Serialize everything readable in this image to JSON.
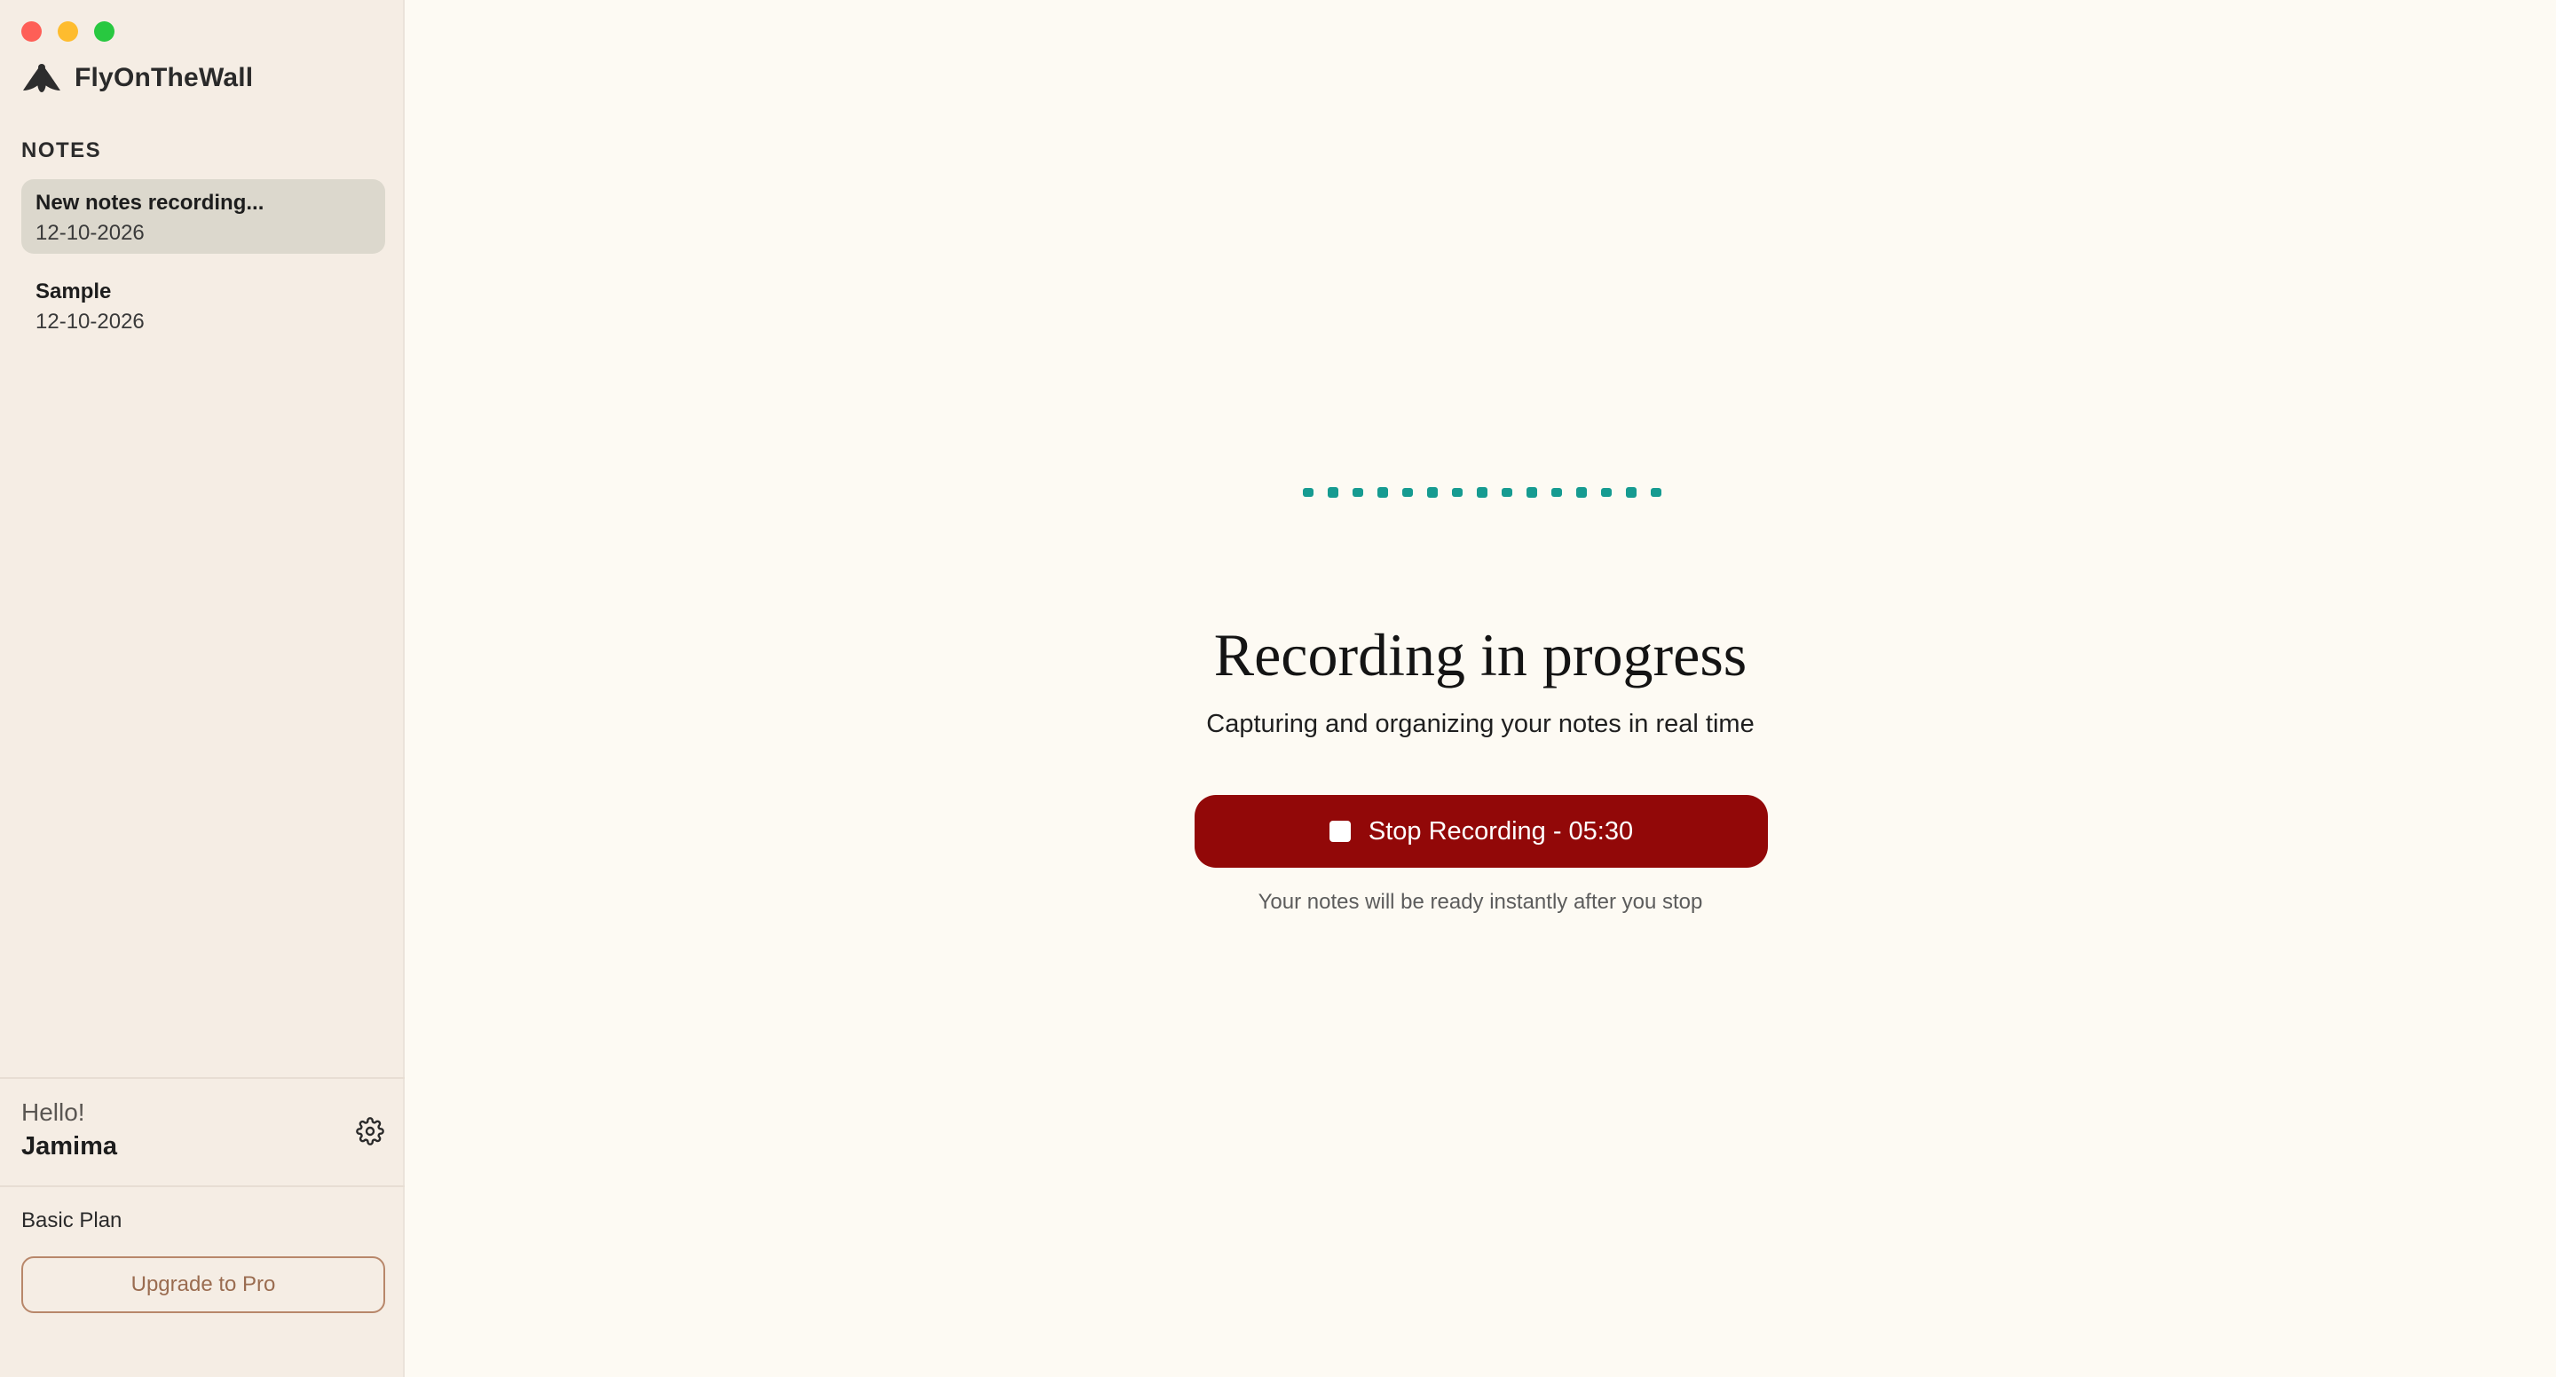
{
  "window": {
    "controls": [
      "close",
      "minimize",
      "maximize"
    ]
  },
  "sidebar": {
    "app_name": "FlyOnTheWall",
    "logo_icon": "fly-logo-icon",
    "notes_heading": "NOTES",
    "notes": [
      {
        "title": "New notes recording...",
        "date": "12-10-2026",
        "active": true
      },
      {
        "title": "Sample",
        "date": "12-10-2026",
        "active": false
      }
    ],
    "greeting": "Hello!",
    "username": "Jamima",
    "settings_icon": "gear-icon",
    "plan": "Basic Plan",
    "upgrade_label": "Upgrade to Pro"
  },
  "main": {
    "title": "Recording in progress",
    "subtitle": "Capturing and organizing your notes in real time",
    "stop_button_label": "Stop Recording - 05:30",
    "stop_icon": "stop-square-icon",
    "hint": "Your notes will be ready instantly after you stop",
    "waveform_bar_count": 15
  },
  "colors": {
    "sidebar_bg": "#f5ede4",
    "main_bg": "#fdfaf3",
    "active_note_bg": "#dcd8cd",
    "stop_button": "#920808",
    "waveform": "#169b91",
    "upgrade_border": "#b8876a"
  }
}
